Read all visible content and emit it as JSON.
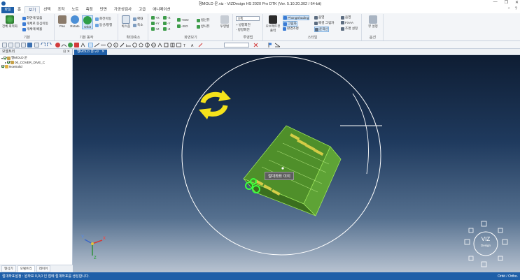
{
  "window": {
    "title": "형MOLD 운.viz - VIZDesign HS 2020 Pro DTK (Ver. 5.10.20.302 / 64-bit)",
    "controls": [
      "—",
      "❐",
      "✕"
    ]
  },
  "menu": {
    "file_label": "파일",
    "tabs": [
      "홈",
      "보기",
      "선택",
      "조작",
      "노트",
      "측정",
      "단면",
      "가공성검사",
      "고급",
      "애니메이션"
    ],
    "active_tab": "보기",
    "right_controls": [
      "⌃",
      "?"
    ]
  },
  "ribbon": {
    "basic": {
      "label": "기본",
      "fit_all": "전체 최적화",
      "items": [
        "화면에 맞춤",
        "개체로 중심이동",
        "개체에 배율"
      ]
    },
    "basic_ops": {
      "label": "기본 동작",
      "pan": "Pan",
      "rotate": "Rotate",
      "orbit": "Orbit",
      "items": [
        "회전이동",
        "등선/평행"
      ]
    },
    "zoom": {
      "label": "확대/축소",
      "zoom_box": "박스줌",
      "items": [
        "확대",
        "축소"
      ]
    },
    "view_dir": {
      "label": "화면보기",
      "col1": [
        "+X",
        "+Y",
        "+Z"
      ],
      "col2": [
        "-X",
        "-Y",
        "-Z"
      ],
      "col3": [
        "+ISO",
        "-ISO"
      ],
      "col4": [
        "법선뷰",
        "방사뷰"
      ],
      "twist": "투영법"
    },
    "projection": {
      "label": "투영법",
      "dropdown": "X축",
      "items": [
        "+ 방향회전",
        "- 방향회전"
      ]
    },
    "style": {
      "label": "스타일",
      "display_view": "오브젝트뷰\n출력",
      "modes": [
        "PhongShading",
        "그림자",
        "환경조명"
      ],
      "modes_right": [
        "음영",
        "배경 그림자",
        "윤곽선"
      ],
      "extra": [
        "음영",
        "FXAA",
        "조명 설정"
      ]
    },
    "options": {
      "label": "옵션",
      "view_settings": "뷰 설정"
    }
  },
  "toolbar": {
    "search_placeholder": ""
  },
  "model_tree": {
    "title": "모델트리",
    "pin": "⊡ ✕",
    "items": [
      {
        "label": "형MOLD 운",
        "level": 0,
        "checked": true
      },
      {
        "label": "00_COVER_DIVE_C",
        "level": 1,
        "checked": true
      },
      {
        "label": "NoeSolid",
        "level": 0,
        "checked": true
      }
    ],
    "tabs": [
      "형식기",
      "모델트리",
      "레이어"
    ],
    "active_tab": "모델트리"
  },
  "viewport": {
    "doc_tab": "형MOLD 운.viz",
    "tooltip": "절대좌표 이이",
    "triad": {
      "x": "X",
      "y": "Y",
      "z": "Z"
    },
    "logo_top": "VIZ",
    "logo_bottom": "Design"
  },
  "status": {
    "message": "절대좌표설정 : 원좌표 0,0,0 인 점에 절대좌표를 생성합니다.",
    "mode": "Orbit / Ortho."
  },
  "colors": {
    "accent": "#1f5fa8",
    "model": "#7fc63a",
    "orbit_icon": "#f5e21b"
  }
}
